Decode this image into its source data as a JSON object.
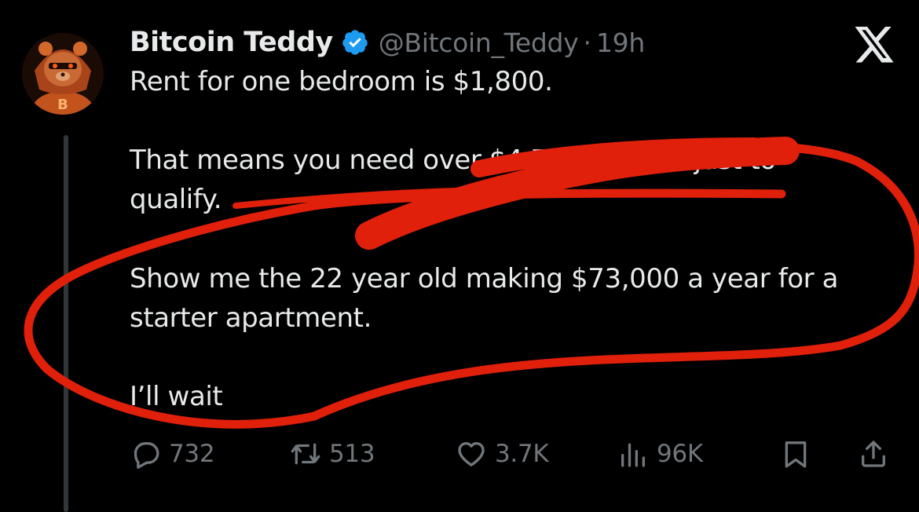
{
  "author": {
    "name": "Bitcoin Teddy",
    "handle": "@Bitcoin_Teddy",
    "separator": "·",
    "time": "19h",
    "verified": true,
    "avatar_icon": "teddy-bear-hoodie-bitcoin-avatar"
  },
  "tweet": {
    "lines": [
      "Rent for one bedroom is $1,800.",
      "That means you need over $4,7",
      "                          nth just to",
      "qualify.",
      "Show me the 22 year old making $73,000 a year for a",
      "starter apartment.",
      "I’ll wait"
    ]
  },
  "actions": {
    "replies": {
      "icon": "reply-icon",
      "count": "732"
    },
    "retweets": {
      "icon": "retweet-icon",
      "count": "513"
    },
    "likes": {
      "icon": "heart-icon",
      "count": "3.7K"
    },
    "views": {
      "icon": "views-icon",
      "count": "96K"
    },
    "bookmark": {
      "icon": "bookmark-icon"
    },
    "share": {
      "icon": "share-icon"
    }
  },
  "colors": {
    "background": "#000000",
    "text": "#e7e9ea",
    "muted": "#71767b",
    "verified_blue": "#1d9bf0",
    "annotation_red": "#e0200a",
    "avatar_orange": "#c2531c"
  }
}
